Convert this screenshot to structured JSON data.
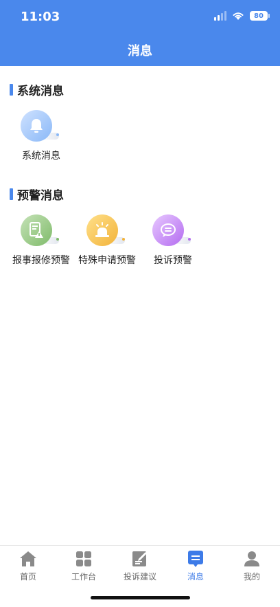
{
  "status": {
    "time": "11:03",
    "battery": "80"
  },
  "header": {
    "title": "消息"
  },
  "sections": [
    {
      "title": "系统消息",
      "items": [
        {
          "label": "系统消息",
          "icon": "bell-icon",
          "color": "#8ab8f7"
        }
      ]
    },
    {
      "title": "预警消息",
      "items": [
        {
          "label": "报事报修预警",
          "icon": "document-warning-icon",
          "color": "#7fbb6a"
        },
        {
          "label": "特殊申请预警",
          "icon": "siren-icon",
          "color": "#f2b33a"
        },
        {
          "label": "投诉预警",
          "icon": "chat-bubble-icon",
          "color": "#b46cf0"
        }
      ]
    }
  ],
  "tabbar": {
    "items": [
      {
        "label": "首页",
        "icon": "home-icon",
        "active": false
      },
      {
        "label": "工作台",
        "icon": "grid-icon",
        "active": false
      },
      {
        "label": "投诉建议",
        "icon": "edit-note-icon",
        "active": false
      },
      {
        "label": "消息",
        "icon": "message-icon",
        "active": true
      },
      {
        "label": "我的",
        "icon": "user-icon",
        "active": false
      }
    ],
    "active_color": "#3d7be8",
    "inactive_color": "#8a8a8a"
  },
  "theme": {
    "primary": "#4a88ec"
  }
}
